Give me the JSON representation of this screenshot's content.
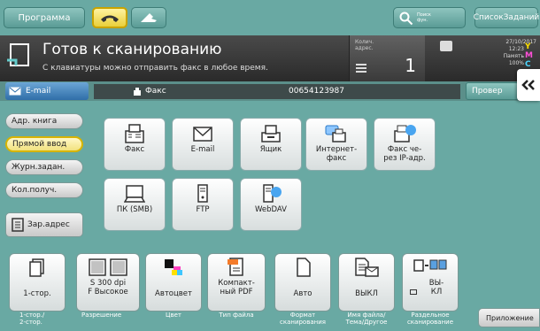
{
  "top": {
    "program": "Программа",
    "search": "Поиск фун.",
    "job_list": "СписокЗаданий"
  },
  "header": {
    "title": "Готов к сканированию",
    "subtitle": "С клавиатуры можно отправить факс в любое время.",
    "counter_label": "Колич. адрес.",
    "counter": "1",
    "date": "27/10/2017",
    "time": "12:23",
    "memory_label": "Память",
    "memory_value": "100%",
    "toner_y": "Y",
    "toner_m": "M",
    "toner_c": "C",
    "toner_k": "K"
  },
  "tabs": {
    "email": "E-mail",
    "fax_label": "Факс",
    "fax_number": "00654123987",
    "check": "Провер"
  },
  "side": {
    "addr_book": "Адр. книга",
    "direct_input": "Прямой ввод",
    "job_log": "Журн.задан.",
    "count": "Кол.получ.",
    "reg_addr": "Зар.адрес"
  },
  "tiles": {
    "fax": "Факс",
    "email": "E-mail",
    "box": "Ящик",
    "ifax_1": "Интернет-",
    "ifax_2": "факс",
    "ipfax_1": "Факс че-",
    "ipfax_2": "рез IP-адр.",
    "pc": "ПК (SMB)",
    "ftp": "FTP",
    "webdav": "WebDAV"
  },
  "bottom": {
    "b1": "1-стор.",
    "b2_1": "S 300 dpi",
    "b2_2": "F Высокое",
    "b3": "Автоцвет",
    "b4_1": "Компакт-",
    "b4_2": "ный PDF",
    "b5": "Авто",
    "b6": "ВЫКЛ",
    "b7_1": "ВЫ-",
    "b7_2": "КЛ",
    "l1_1": "1-стор./",
    "l1_2": "2-стор.",
    "l2": "Разрешение",
    "l3": "Цвет",
    "l4": "Тип файла",
    "l5_1": "Формат",
    "l5_2": "сканирования",
    "l6_1": "Имя файла/",
    "l6_2": "Тема/Другое",
    "l7_1": "Раздельное",
    "l7_2": "сканирование",
    "apps": "Приложение"
  }
}
